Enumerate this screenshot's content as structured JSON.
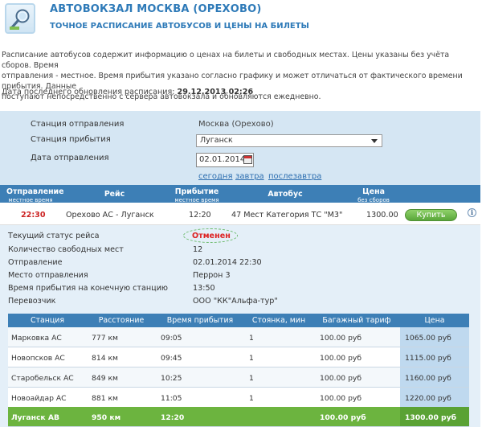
{
  "header": {
    "title": "АВТОВОКЗАЛ МОСКВА (ОРЕХОВО)",
    "subtitle": "ТОЧНОЕ РАСПИСАНИЕ АВТОБУСОВ И ЦЕНЫ НА БИЛЕТЫ",
    "logo_icon": "magnifier-icon"
  },
  "intro": {
    "line1": "Расписание автобусов содержит информацию о ценах на билеты и свободных местах. Цены указаны без учёта сборов. Время",
    "line2": "отправления - местное. Время прибытия указано согласно графику и может отличаться от фактического времени прибытия. Данные",
    "line3": "поступают непосредственно с сервера автовокзала и обновляются ежедневно."
  },
  "updated": {
    "label": "Дата последнего обновления расписания:",
    "value": "29.12.2013 02:26"
  },
  "form": {
    "departure_label": "Станция отправления",
    "departure_value": "Москва (Орехово)",
    "arrival_label": "Станция прибытия",
    "arrival_value": "Луганск",
    "date_label": "Дата отправления",
    "date_value": "02.01.2014",
    "links": [
      "сегодня",
      "завтра",
      "послезавтра"
    ]
  },
  "table": {
    "columns": [
      {
        "title": "Отправление",
        "sub": "местное время"
      },
      {
        "title": "Рейс",
        "sub": ""
      },
      {
        "title": "Прибытие",
        "sub": "местное время"
      },
      {
        "title": "Автобус",
        "sub": ""
      },
      {
        "title": "Цена",
        "sub": "без сборов"
      }
    ],
    "trip": {
      "departure": "22:30",
      "route": "Орехово АС - Луганск",
      "arrival": "12:20",
      "bus": "47 Мест Категория ТС \"М3\"",
      "price": "1300.00",
      "buy_label": "Купить",
      "info_icon": "info-icon"
    }
  },
  "details": {
    "rows": [
      {
        "label": "Текущий статус рейса",
        "value": "Отменен"
      },
      {
        "label": "Количество свободных мест",
        "value": "12"
      },
      {
        "label": "Отправление",
        "value": "02.01.2014 22:30"
      },
      {
        "label": "Место отправления",
        "value": "Перрон 3"
      },
      {
        "label": "Время прибытия на конечную станцию",
        "value": "13:50"
      },
      {
        "label": "Перевозчик",
        "value": "ООО \"КК\"Альфа-тур\""
      }
    ]
  },
  "route": {
    "columns": [
      "Станция",
      "Расстояние",
      "Время прибытия",
      "Стоянка, мин",
      "Багажный тариф",
      "Цена"
    ],
    "rows": [
      [
        "Марковка АС",
        "777 км",
        "09:05",
        "1",
        "100.00 руб",
        "1065.00 руб"
      ],
      [
        "Новопсков АС",
        "814 км",
        "09:45",
        "1",
        "100.00 руб",
        "1115.00 руб"
      ],
      [
        "Старобельск АС",
        "849 км",
        "10:25",
        "1",
        "100.00 руб",
        "1160.00 руб"
      ],
      [
        "Новоайдар АС",
        "881 км",
        "11:05",
        "1",
        "100.00 руб",
        "1220.00 руб"
      ],
      [
        "Луганск АВ",
        "950 км",
        "12:20",
        "",
        "100.00 руб",
        "1300.00 руб"
      ]
    ]
  },
  "colors": {
    "accent": "#2e7ab8",
    "header_bar": "#3d7fb6",
    "panel": "#d5e6f3",
    "status_cancelled": "#dd2222",
    "buy_green": "#5aa73a"
  }
}
